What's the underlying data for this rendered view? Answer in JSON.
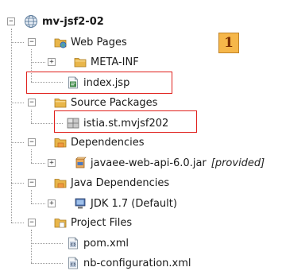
{
  "tree": {
    "project": {
      "label": "mv-jsf2-02",
      "icon": "globe-project-icon"
    },
    "web_pages": {
      "label": "Web Pages",
      "icon": "web-pages-folder-icon"
    },
    "meta_inf": {
      "label": "META-INF",
      "icon": "folder-icon"
    },
    "index_jsp": {
      "label": "index.jsp",
      "icon": "jsp-file-icon"
    },
    "source_packages": {
      "label": "Source Packages",
      "icon": "source-packages-folder-icon"
    },
    "package": {
      "label": "istia.st.mvjsf202",
      "icon": "package-icon"
    },
    "dependencies": {
      "label": "Dependencies",
      "icon": "dependencies-folder-icon"
    },
    "javaee_jar": {
      "label": "javaee-web-api-6.0.jar",
      "note": "[provided]",
      "icon": "jar-icon"
    },
    "java_dependencies": {
      "label": "Java Dependencies",
      "icon": "java-dependencies-folder-icon"
    },
    "jdk": {
      "label": "JDK 1.7 (Default)",
      "icon": "jdk-library-icon"
    },
    "project_files": {
      "label": "Project Files",
      "icon": "project-files-folder-icon"
    },
    "pom_xml": {
      "label": "pom.xml",
      "icon": "xml-file-icon"
    },
    "nb_config": {
      "label": "nb-configuration.xml",
      "icon": "xml-file-icon"
    }
  },
  "badge": {
    "label": "1"
  },
  "colors": {
    "highlight_border": "#e0201c",
    "badge_fill": "#f6b74a",
    "folder": "#e9b64a"
  }
}
